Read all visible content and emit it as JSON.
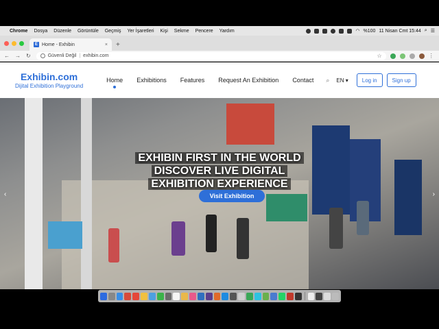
{
  "menubar": {
    "app": "Chrome",
    "items": [
      "Dosya",
      "Düzenle",
      "Görüntüle",
      "Geçmiş",
      "Yer İşaretleri",
      "Kişi",
      "Sekme",
      "Pencere",
      "Yardım"
    ],
    "battery": "%100",
    "datetime": "11 Nisan Cmt  15:44"
  },
  "browser": {
    "tab_title": "Home - Exhibin",
    "tab_favicon": "E",
    "security": "Güvenli Değil",
    "url": "exhibin.com"
  },
  "site": {
    "logo_name": "Exhibin.com",
    "logo_tagline": "Dijital Exhibition Playground",
    "nav": [
      "Home",
      "Exhibitions",
      "Features",
      "Request An Exhibition",
      "Contact"
    ],
    "lang": "EN ▾",
    "login": "Log in",
    "signup": "Sign up",
    "accent": "#2e6fd8",
    "hero": {
      "line1": "EXHIBIN FIRST IN THE WORLD",
      "line2": "DISCOVER LIVE DIGITAL",
      "line3": "EXHIBITION EXPERIENCE",
      "cta": "Visit Exhibition"
    }
  }
}
